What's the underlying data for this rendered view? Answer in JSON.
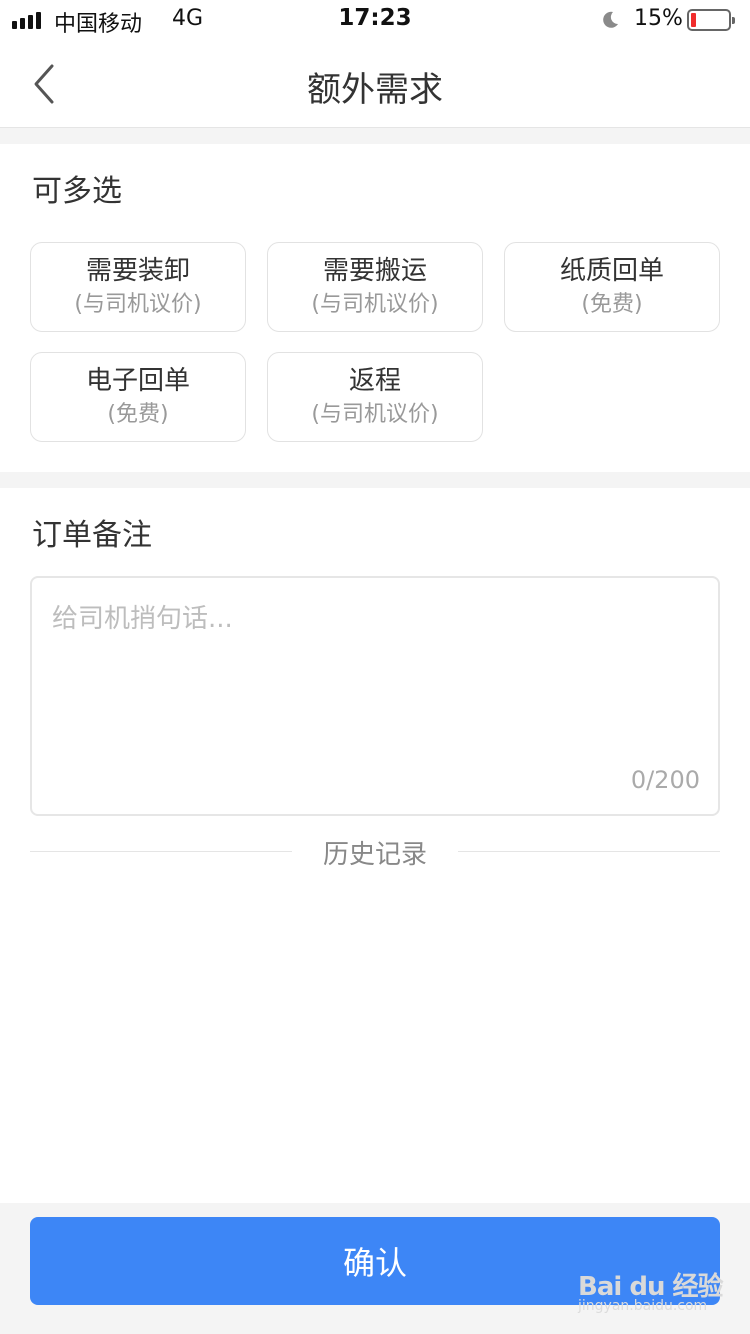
{
  "status_bar": {
    "carrier": "中国移动",
    "network": "4G",
    "time": "17:23",
    "battery_percent": "15%",
    "battery_level": 0.15,
    "battery_color": "#f02c2c"
  },
  "nav": {
    "title": "额外需求",
    "back_icon": "chevron-left-icon"
  },
  "options_section": {
    "title": "可多选",
    "options": [
      {
        "label": "需要装卸",
        "note": "(与司机议价)"
      },
      {
        "label": "需要搬运",
        "note": "(与司机议价)"
      },
      {
        "label": "纸质回单",
        "note": "(免费)"
      },
      {
        "label": "电子回单",
        "note": "(免费)"
      },
      {
        "label": "返程",
        "note": "(与司机议价)"
      }
    ]
  },
  "remarks_section": {
    "title": "订单备注",
    "placeholder": "给司机捎句话...",
    "value": "",
    "char_count": "0/200"
  },
  "history": {
    "label": "历史记录"
  },
  "footer": {
    "confirm_label": "确认",
    "accent_color": "#3d86f6"
  },
  "watermark": {
    "brand": "Bai du 经验",
    "url": "jingyan.baidu.com"
  }
}
